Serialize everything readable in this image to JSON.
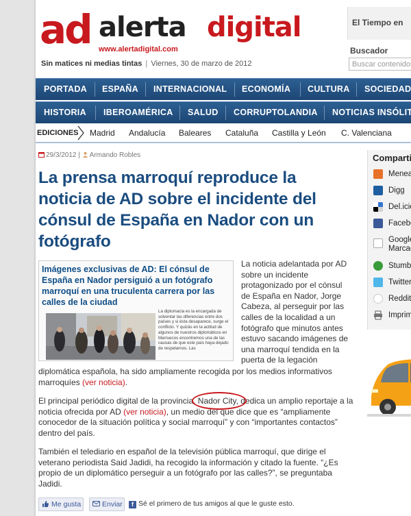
{
  "header": {
    "logo_ad": "ad",
    "logo_alerta": "alerta",
    "logo_digital": "digital",
    "logo_url": "www.alertadigital.com",
    "tagline_bold": "Sin matices ni medias tintas",
    "tagline_sep": "|",
    "date": "Viernes, 30 de marzo de 2012",
    "weather_label": "El Tiempo en",
    "search_label": "Buscador",
    "search_placeholder": "Buscar contenidos"
  },
  "nav_primary": [
    "PORTADA",
    "ESPAÑA",
    "INTERNACIONAL",
    "ECONOMÍA",
    "CULTURA",
    "SOCIEDAD"
  ],
  "nav_secondary": [
    "HISTORIA",
    "IBEROAMÉRICA",
    "SALUD",
    "CORRUPTOLANDIA",
    "NOTICIAS INSÓLITAS"
  ],
  "editions": {
    "label": "EDICIONES",
    "items": [
      "Madrid",
      "Andalucía",
      "Baleares",
      "Cataluña",
      "Castilla y León",
      "C. Valenciana"
    ]
  },
  "article": {
    "date": "29/3/2012",
    "sep": "|",
    "author": "Armando Robles",
    "title": "La prensa marroquí reproduce la noticia de AD sobre el incidente del cónsul de España en Nador con un fotógrafo",
    "embed_headline": "Imágenes exclusivas de AD: El cónsul de España en Nador persiguió a un fotógrafo marroquí en una truculenta carrera por las calles de la ciudad",
    "embed_body": "La diplomacia es la encargada de solventar las diferencias entre dos países y si ésta desaparece, surge el conflicto. Y quizás en la actitud de algunos de nuestros diplomáticos en Marruecos encontremos una de las causas de que este país haya dejado de respetarnos. Las",
    "p1_a": "La noticia adelantada por AD sobre un incidente protagonizado por el cónsul de España en Nador, Jorge Cabeza, al perseguir por las calles de la localidad a un fotógrafo que minutos antes estuvo sacando imágenes de una marroquí tendida en la puerta de la legación",
    "p1_b": "diplomática española, ha sido ampliamente recogida por los medios informativos marroquíes ",
    "link_ver_noticia": "(ver noticia)",
    "p1_end": ".",
    "p2_a": "El principal periódico digital de la provincia, ",
    "p2_highlight": "Nador City",
    "p2_b": ", dedica un amplio reportaje a la noticia ofrecida por AD ",
    "p2_c": ", un medio del que dice que es “ampliamente conocedor de la situación política y social marroquí” y con “importantes contactos” dentro del país.",
    "p3": "También el telediario en español de la televisión pública marroquí, que dirige el veterano periodista Said Jadidi, ha recogido la información y citado la fuente. “¿Es propio de un diplomático perseguir a un fotógrafo por las calles?”, se preguntaba Jadidi."
  },
  "share_bar": {
    "like_label": "Me gusta",
    "send_label": "Enviar",
    "social_text": "Sé el primero de tus amigos al que le guste esto."
  },
  "share_sidebar": {
    "title": "Compartir",
    "items": [
      {
        "label": "Meneame",
        "icon": "meneame-icon",
        "color": "#e8712a"
      },
      {
        "label": "Digg",
        "icon": "digg-icon",
        "color": "#1d5fa0"
      },
      {
        "label": "Del.icio.us",
        "icon": "delicious-icon",
        "color": "#3274d1"
      },
      {
        "label": "Facebook",
        "icon": "facebook-icon",
        "color": "#3b5998"
      },
      {
        "label": "Google",
        "label2": "Marcadores",
        "icon": "google-icon",
        "color": "#ffffff"
      },
      {
        "label": "StumbleUpon",
        "icon": "stumbleupon-icon",
        "color": "#3a9b3a"
      },
      {
        "label": "Twitter",
        "icon": "twitter-icon",
        "color": "#4fb6ea"
      },
      {
        "label": "Reddit",
        "icon": "reddit-icon",
        "color": "#ff5700"
      },
      {
        "label": "Imprimir",
        "icon": "print-icon",
        "color": "#777777"
      }
    ]
  },
  "colors": {
    "brand_red": "#c8191e",
    "nav_blue": "#1c4674",
    "title_blue": "#1a4c7f"
  }
}
